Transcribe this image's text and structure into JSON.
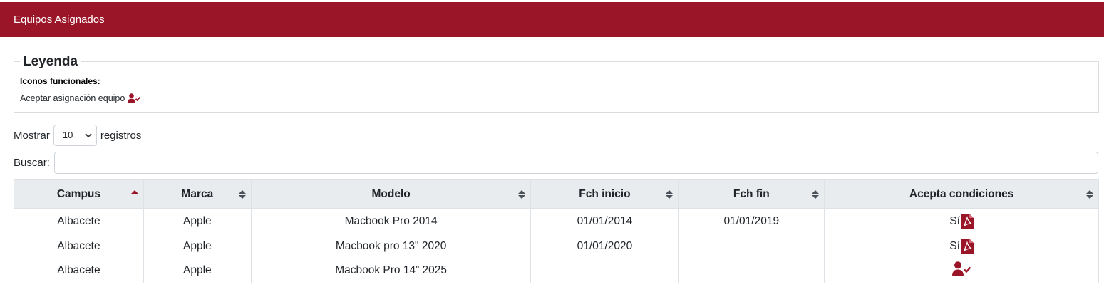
{
  "header": {
    "title": "Equipos Asignados"
  },
  "legend": {
    "title": "Leyenda",
    "subtitle": "Iconos funcionales:",
    "item_label": "Aceptar asignación equipo",
    "item_icon": "user-check-icon"
  },
  "length": {
    "prefix": "Mostrar",
    "value": "10",
    "suffix": "registros"
  },
  "search": {
    "label": "Buscar:",
    "value": ""
  },
  "table": {
    "columns": [
      "Campus",
      "Marca",
      "Modelo",
      "Fch inicio",
      "Fch fin",
      "Acepta condiciones"
    ],
    "sorted_column": "Campus",
    "rows": [
      {
        "campus": "Albacete",
        "marca": "Apple",
        "modelo": "Macbook Pro 2014",
        "inicio": "01/01/2014",
        "fin": "01/01/2019",
        "acepta": "Sí",
        "icon": "pdf-icon"
      },
      {
        "campus": "Albacete",
        "marca": "Apple",
        "modelo": "Macbook pro 13\" 2020",
        "inicio": "01/01/2020",
        "fin": "",
        "acepta": "Sí",
        "icon": "pdf-icon"
      },
      {
        "campus": "Albacete",
        "marca": "Apple",
        "modelo": "Macbook Pro 14” 2025",
        "inicio": "",
        "fin": "",
        "acepta": "",
        "icon": "user-check-icon"
      }
    ]
  },
  "colors": {
    "brand": "#9b1528",
    "header_bg": "#e9ecef"
  }
}
